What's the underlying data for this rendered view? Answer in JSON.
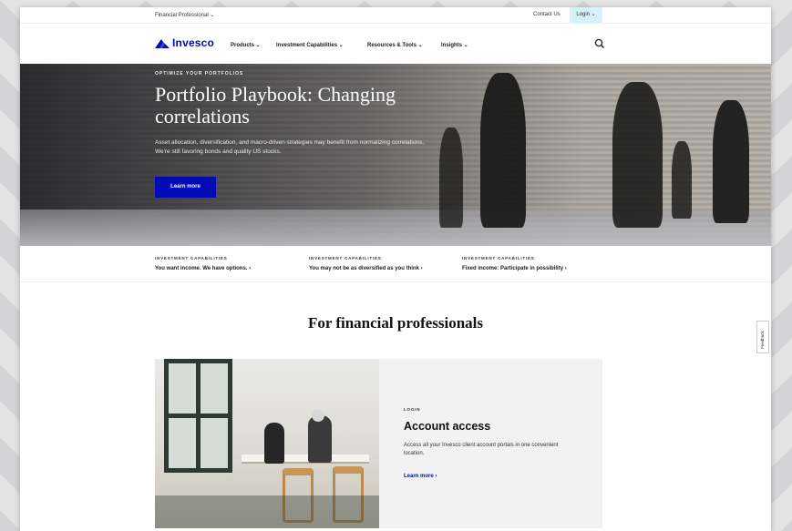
{
  "utility": {
    "audience": "Financial Professional ⌄",
    "contact": "Contact Us",
    "login": "Login ⌄"
  },
  "nav": {
    "brand": "Invesco",
    "items": [
      {
        "label": "Products ⌄"
      },
      {
        "label": "Investment Capabilities ⌄"
      },
      {
        "label": "Resources & Tools ⌄"
      },
      {
        "label": "Insights ⌄"
      }
    ],
    "search_icon": "search-icon"
  },
  "hero": {
    "eyebrow": "OPTIMIZE YOUR PORTFOLIOS",
    "title": "Portfolio Playbook: Changing correlations",
    "description": "Asset allocation, diversification, and macro-driven strategies may benefit from normalizing correlations. We're still favoring bonds and quality US stocks.",
    "button": "Learn more"
  },
  "capabilities": [
    {
      "eyebrow": "INVESTMENT CAPABILITIES",
      "link": "You want income. We have options.  ›"
    },
    {
      "eyebrow": "INVESTMENT CAPABILITIES",
      "link": "You may not be as diversified as you think  ›"
    },
    {
      "eyebrow": "INVESTMENT CAPABILITIES",
      "link": "Fixed income: Participate in possibility  ›"
    }
  ],
  "section": {
    "title": "For financial professionals"
  },
  "card": {
    "eyebrow": "LOGIN",
    "title": "Account access",
    "description": "Access all your Invesco client account portals in one convenient location.",
    "link": "Learn more  ›"
  },
  "feedback": {
    "label": "Feedback"
  },
  "colors": {
    "brand_blue": "#000ab5",
    "login_bg": "#d6f1f7",
    "card_bg": "#f2f2f2"
  }
}
